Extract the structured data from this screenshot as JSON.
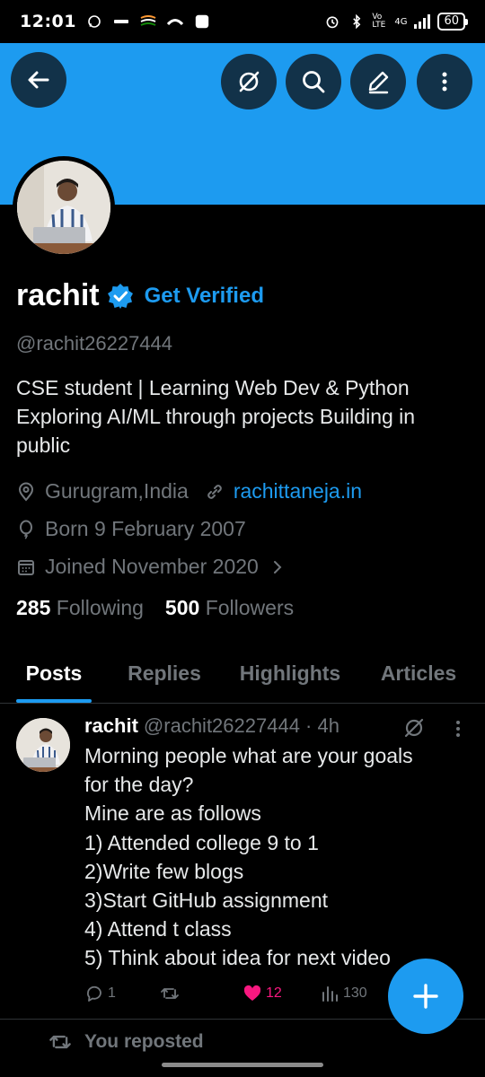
{
  "status_bar": {
    "time": "12:01",
    "battery": "60",
    "network": "4G",
    "volte": "Vo LTE"
  },
  "header": {
    "icons": [
      "back-arrow-icon",
      "grok-icon",
      "search-icon",
      "edit-icon",
      "more-vertical-icon"
    ]
  },
  "colors": {
    "accent": "#1d9bf0",
    "banner": "#1d9bf0",
    "background": "#000000",
    "muted": "#71767b",
    "like": "#f91880"
  },
  "profile": {
    "name": "rachit",
    "get_verified": "Get Verified",
    "handle": "@rachit26227444",
    "bio": "CSE student | Learning Web Dev & Python Exploring AI/ML through projects Building in public",
    "location": "Gurugram,India",
    "website": "rachittaneja.in",
    "born": "Born 9 February 2007",
    "joined": "Joined November 2020",
    "following_count": "285",
    "following_label": "Following",
    "followers_count": "500",
    "followers_label": "Followers"
  },
  "tabs": [
    {
      "label": "Posts",
      "active": true
    },
    {
      "label": "Replies",
      "active": false
    },
    {
      "label": "Highlights",
      "active": false
    },
    {
      "label": "Articles",
      "active": false
    }
  ],
  "post": {
    "name": "rachit",
    "meta": "@rachit26227444 · 4h",
    "lines": [
      "Morning people what are your goals",
      "for the day?",
      "Mine are as follows",
      "1) Attended college 9 to 1",
      "2)Write few blogs",
      "3)Start GitHub assignment",
      "4) Attend t class",
      "5) Think about idea for next video"
    ],
    "replies": "1",
    "reposts": "",
    "likes": "12",
    "views": "130"
  },
  "reposted_label": "You reposted"
}
